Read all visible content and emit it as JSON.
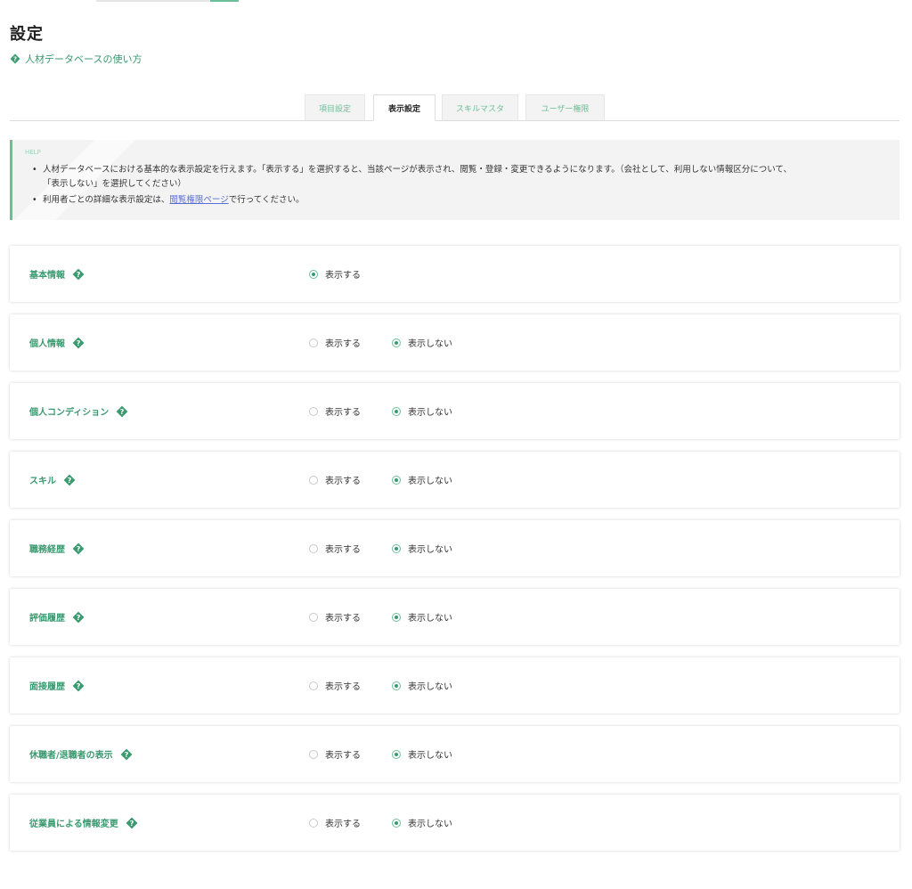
{
  "colors": {
    "accent": "#3a9a70",
    "accent_light": "#6bbf97",
    "link": "#5a6fd6"
  },
  "header": {
    "title": "設定",
    "help_link": "人材データベースの使い方",
    "help_link_icon": "diamond-question-icon"
  },
  "tabs": [
    {
      "label": "項目設定",
      "active": false
    },
    {
      "label": "表示設定",
      "active": true
    },
    {
      "label": "スキルマスタ",
      "active": false
    },
    {
      "label": "ユーザー権限",
      "active": false
    }
  ],
  "help": {
    "label": "HELP",
    "item1": "人材データベースにおける基本的な表示設定を行えます。「表示する」を選択すると、当該ページが表示され、閲覧・登録・変更できるようになります。（会社として、利用しない情報区分について、",
    "item1_cont": "「表示しない」を選択してください）",
    "item2_pre": "利用者ごとの詳細な表示設定は、",
    "item2_link": "閲覧権限ページ",
    "item2_post": "で行ってください。"
  },
  "option_labels": {
    "show": "表示する",
    "hide": "表示しない"
  },
  "settings": [
    {
      "label": "基本情報",
      "selected": "show",
      "has_hide": false
    },
    {
      "label": "個人情報",
      "selected": "hide",
      "has_hide": true
    },
    {
      "label": "個人コンディション",
      "selected": "hide",
      "has_hide": true
    },
    {
      "label": "スキル",
      "selected": "hide",
      "has_hide": true
    },
    {
      "label": "職務経歴",
      "selected": "hide",
      "has_hide": true
    },
    {
      "label": "評価履歴",
      "selected": "hide",
      "has_hide": true
    },
    {
      "label": "面接履歴",
      "selected": "hide",
      "has_hide": true
    },
    {
      "label": "休職者/退職者の表示",
      "selected": "hide",
      "has_hide": true
    },
    {
      "label": "従業員による情報変更",
      "selected": "hide",
      "has_hide": true
    }
  ]
}
